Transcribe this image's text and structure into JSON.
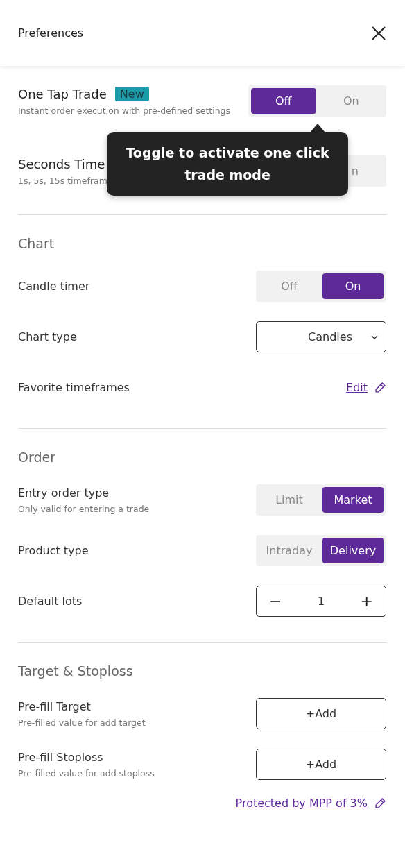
{
  "header": {
    "title": "Preferences"
  },
  "top_rows": [
    {
      "kind": "toggle",
      "title": "One Tap Trade",
      "badge": "New",
      "subtitle": "Instant order execution with pre-defined settings",
      "options": [
        {
          "label": "Off",
          "selected": true
        },
        {
          "label": "On",
          "selected": false
        }
      ]
    },
    {
      "kind": "partial",
      "title": "Seconds Time",
      "subtitle": "1s, 5s, 15s timefram",
      "toggle_text": "n"
    }
  ],
  "tooltip": {
    "text": "Toggle to activate one click trade mode"
  },
  "sections": [
    {
      "heading": "Chart",
      "rows": [
        {
          "kind": "toggle",
          "title": "Candle timer",
          "options": [
            {
              "label": "Off",
              "selected": false
            },
            {
              "label": "On",
              "selected": true
            }
          ]
        },
        {
          "kind": "select",
          "title": "Chart type",
          "value": "Candles"
        },
        {
          "kind": "link",
          "title": "Favorite timeframes",
          "link": "Edit"
        }
      ]
    },
    {
      "heading": "Order",
      "rows": [
        {
          "kind": "toggle",
          "title": "Entry order type",
          "subtitle": "Only valid for entering a trade",
          "options": [
            {
              "label": "Limit",
              "selected": false
            },
            {
              "label": "Market",
              "selected": true
            }
          ]
        },
        {
          "kind": "toggle",
          "title": "Product type",
          "options": [
            {
              "label": "Intraday",
              "selected": false
            },
            {
              "label": "Delivery",
              "selected": true
            }
          ]
        },
        {
          "kind": "stepper",
          "title": "Default lots",
          "minus": "−",
          "value": "1",
          "plus": "+"
        }
      ]
    },
    {
      "heading": "Target & Stoploss",
      "rows": [
        {
          "kind": "add",
          "title": "Pre-fill Target",
          "subtitle": "Pre-filled value for add target",
          "button": "+Add"
        },
        {
          "kind": "add",
          "title": "Pre-fill Stoploss",
          "subtitle": "Pre-filled value for add stoploss",
          "button": "+Add"
        }
      ]
    }
  ],
  "footer_link": "Protected by MPP of 3%"
}
